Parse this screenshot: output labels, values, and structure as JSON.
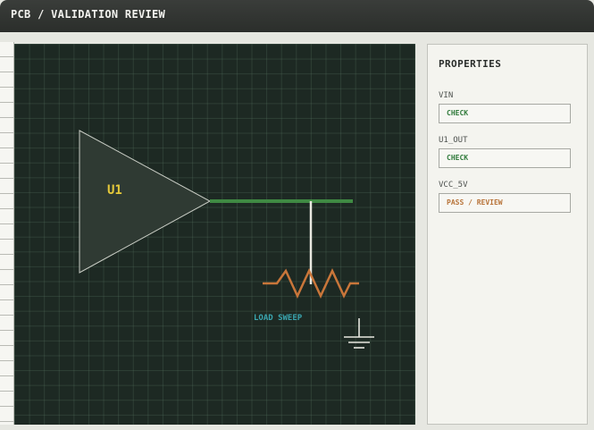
{
  "header": {
    "title": "PCB / VALIDATION REVIEW"
  },
  "canvas": {
    "component_label": "U1",
    "annotation": "LOAD SWEEP"
  },
  "properties": {
    "heading": "PROPERTIES",
    "items": [
      {
        "label": "VIN",
        "value": "CHECK",
        "color": "#2f7a3a"
      },
      {
        "label": "U1_OUT",
        "value": "CHECK",
        "color": "#2f7a3a"
      },
      {
        "label": "VCC_5V",
        "value": "PASS / REVIEW",
        "color": "#b8743a"
      }
    ]
  },
  "colors": {
    "canvas_bg": "#1d2923",
    "net_green": "#3f8a43",
    "resistor": "#c9763a",
    "label_yellow": "#e5c93a",
    "annotation_cyan": "#3aa6b0"
  }
}
